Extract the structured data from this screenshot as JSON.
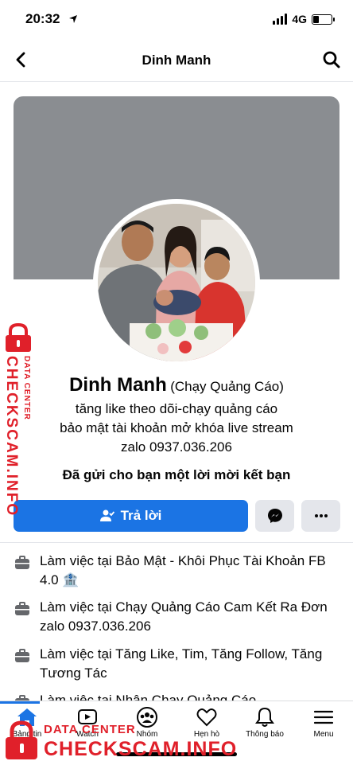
{
  "status_bar": {
    "time": "20:32",
    "network": "4G"
  },
  "nav": {
    "title": "Dinh Manh"
  },
  "profile": {
    "name": "Dinh Manh",
    "alternate_name": "(Chạy Quảng Cáo)",
    "bio_lines": [
      "tăng like theo dõi-chạy quảng cáo",
      "bảo mật tài khoản mở khóa live stream",
      "zalo 0937.036.206"
    ],
    "request_notice": "Đã gửi cho bạn một lời mời kết bạn"
  },
  "actions": {
    "reply_label": "Trả lời"
  },
  "work": [
    {
      "text": "Làm việc tại Bảo Mật - Khôi Phục Tài Khoản FB 4.0 🏦"
    },
    {
      "text": "Làm việc tại Chạy Quảng Cáo Cam Kết Ra Đơn zalo 0937.036.206"
    },
    {
      "text": "Làm việc tại Tăng Like, Tim, Tăng Follow, Tăng Tương Tác"
    },
    {
      "text": "Làm việc tại Nhận Chạy Quảng Cáo"
    }
  ],
  "tabs": [
    {
      "label": "Bảng tin",
      "icon": "home-icon"
    },
    {
      "label": "Watch",
      "icon": "watch-icon"
    },
    {
      "label": "Nhóm",
      "icon": "groups-icon"
    },
    {
      "label": "Hẹn hò",
      "icon": "dating-icon"
    },
    {
      "label": "Thông báo",
      "icon": "bell-icon"
    },
    {
      "label": "Menu",
      "icon": "menu-icon"
    }
  ],
  "watermark": {
    "side_top": "DATA CENTER",
    "side_main": "CHECKSCAM.INFO",
    "bottom_top": "DATA CENTER",
    "bottom_main": "CHECKSCAM.INFO"
  },
  "colors": {
    "accent": "#1b74e4",
    "cover": "#8a8d91",
    "watermark": "#e0202a"
  }
}
